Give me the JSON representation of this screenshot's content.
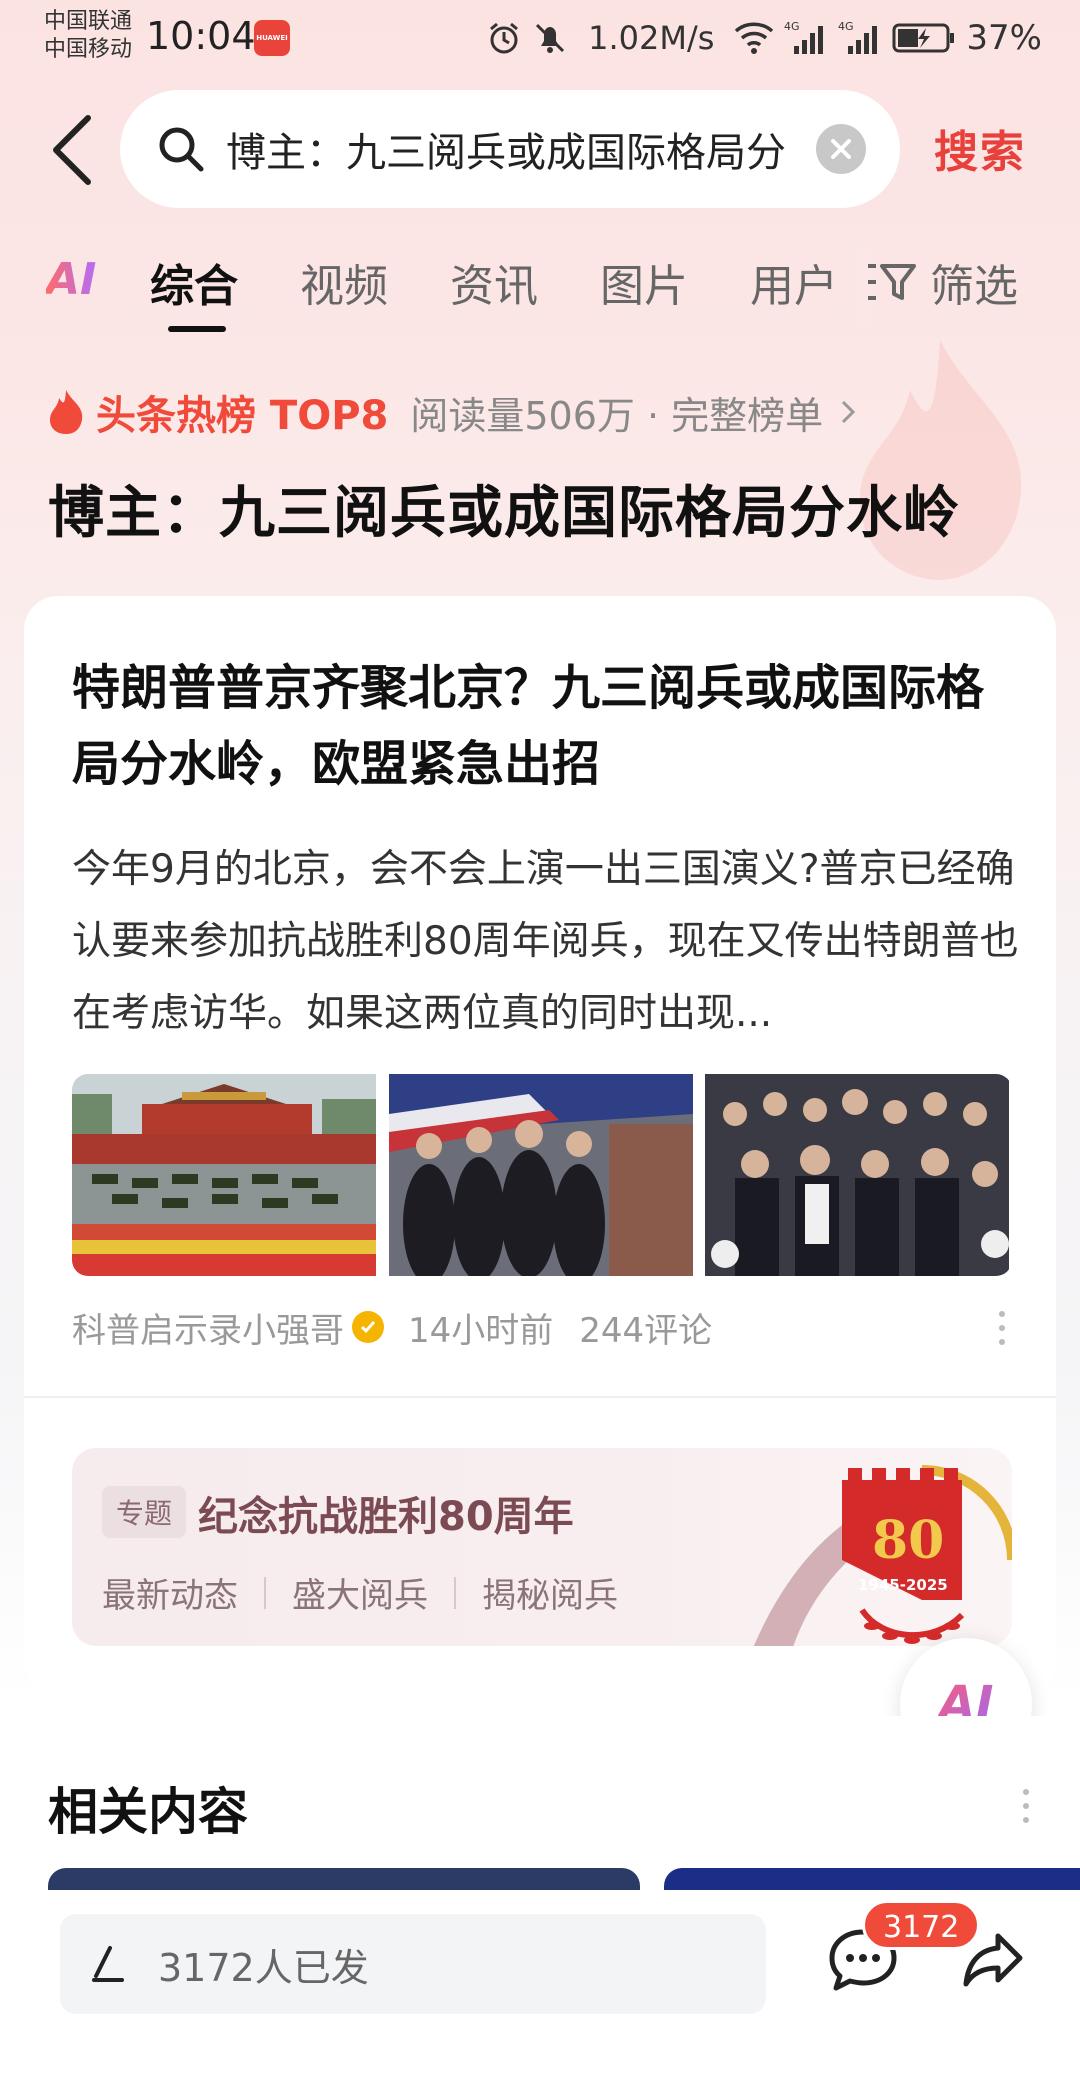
{
  "status_bar": {
    "carrier1": "中国联通",
    "carrier2": "中国移动",
    "time": "10:04",
    "app_badge": "HUAWEI",
    "net_speed": "1.02M/s",
    "battery": "37%",
    "signal_tag1": "4G",
    "signal_tag2": "4G"
  },
  "search": {
    "query": "博主：九三阅兵或成国际格局分水岭",
    "submit_label": "搜索"
  },
  "tabs": {
    "ai_label": "AI",
    "items": [
      "综合",
      "视频",
      "资讯",
      "图片",
      "用户"
    ],
    "active_index": 0,
    "filter_label": "筛选"
  },
  "hot": {
    "label": "头条热榜 TOP8",
    "meta": "阅读量506万 · 完整榜单",
    "headline": "博主：九三阅兵或成国际格局分水岭"
  },
  "article": {
    "title": "特朗普普京齐聚北京？九三阅兵或成国际格局分水岭，欧盟紧急出招",
    "summary": "今年9月的北京，会不会上演一出三国演义?普京已经确认要来参加抗战胜利80周年阅兵，现在又传出特朗普也在考虑访华。如果这两位真的同时出现...",
    "author": "科普启示录小强哥",
    "time_ago": "14小时前",
    "comments": "244评论"
  },
  "topic": {
    "tag": "专题",
    "title": "纪念抗战胜利80周年",
    "links": [
      "最新动态",
      "盛大阅兵",
      "揭秘阅兵"
    ],
    "emblem_number": "80",
    "emblem_years": "1945-2025"
  },
  "ai_fab_label": "AI",
  "related": {
    "title": "相关内容"
  },
  "bottom": {
    "comment_placeholder": "3172人已发",
    "comment_count": "3172"
  },
  "colors": {
    "accent_red": "#e8413c",
    "hot_red": "#f04a3a",
    "topic_text": "#7b4a52"
  },
  "icons": [
    "back-icon",
    "search-icon",
    "clear-icon",
    "filter-icon",
    "flame-icon",
    "verified-icon",
    "more-icon",
    "pen-icon",
    "comment-icon",
    "share-icon"
  ]
}
